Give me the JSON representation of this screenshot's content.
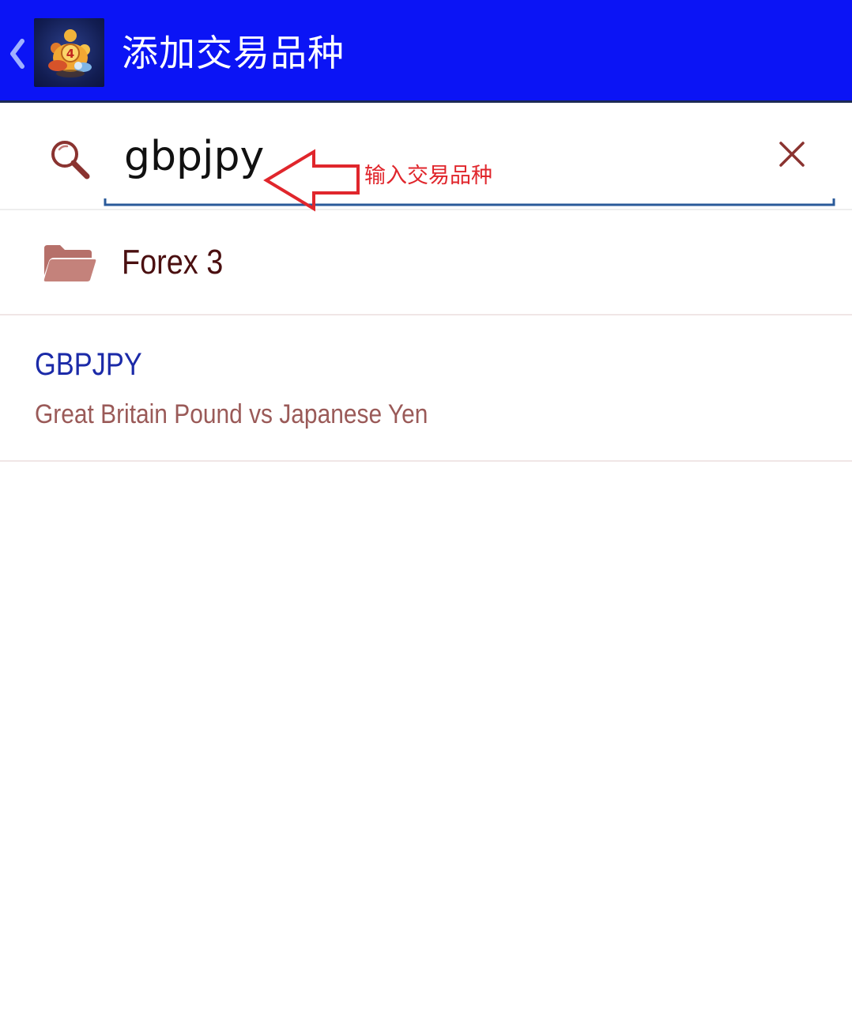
{
  "appbar": {
    "title": "添加交易品种",
    "background_color": "#0b14f5",
    "back_icon": "chevron-left-icon",
    "logo_icon": "metatrader-4-logo-icon"
  },
  "search": {
    "value": "gbpjpy",
    "icon": "search-icon",
    "clear_icon": "close-icon",
    "underline_color": "#2a5a9a"
  },
  "annotation": {
    "text": "输入交易品种",
    "color": "#e0262c",
    "icon": "left-arrow-icon"
  },
  "results": {
    "folder": {
      "label": "Forex 3",
      "icon": "folder-open-icon"
    },
    "symbols": [
      {
        "name": "GBPJPY",
        "description": "Great Britain Pound vs Japanese Yen"
      }
    ]
  }
}
